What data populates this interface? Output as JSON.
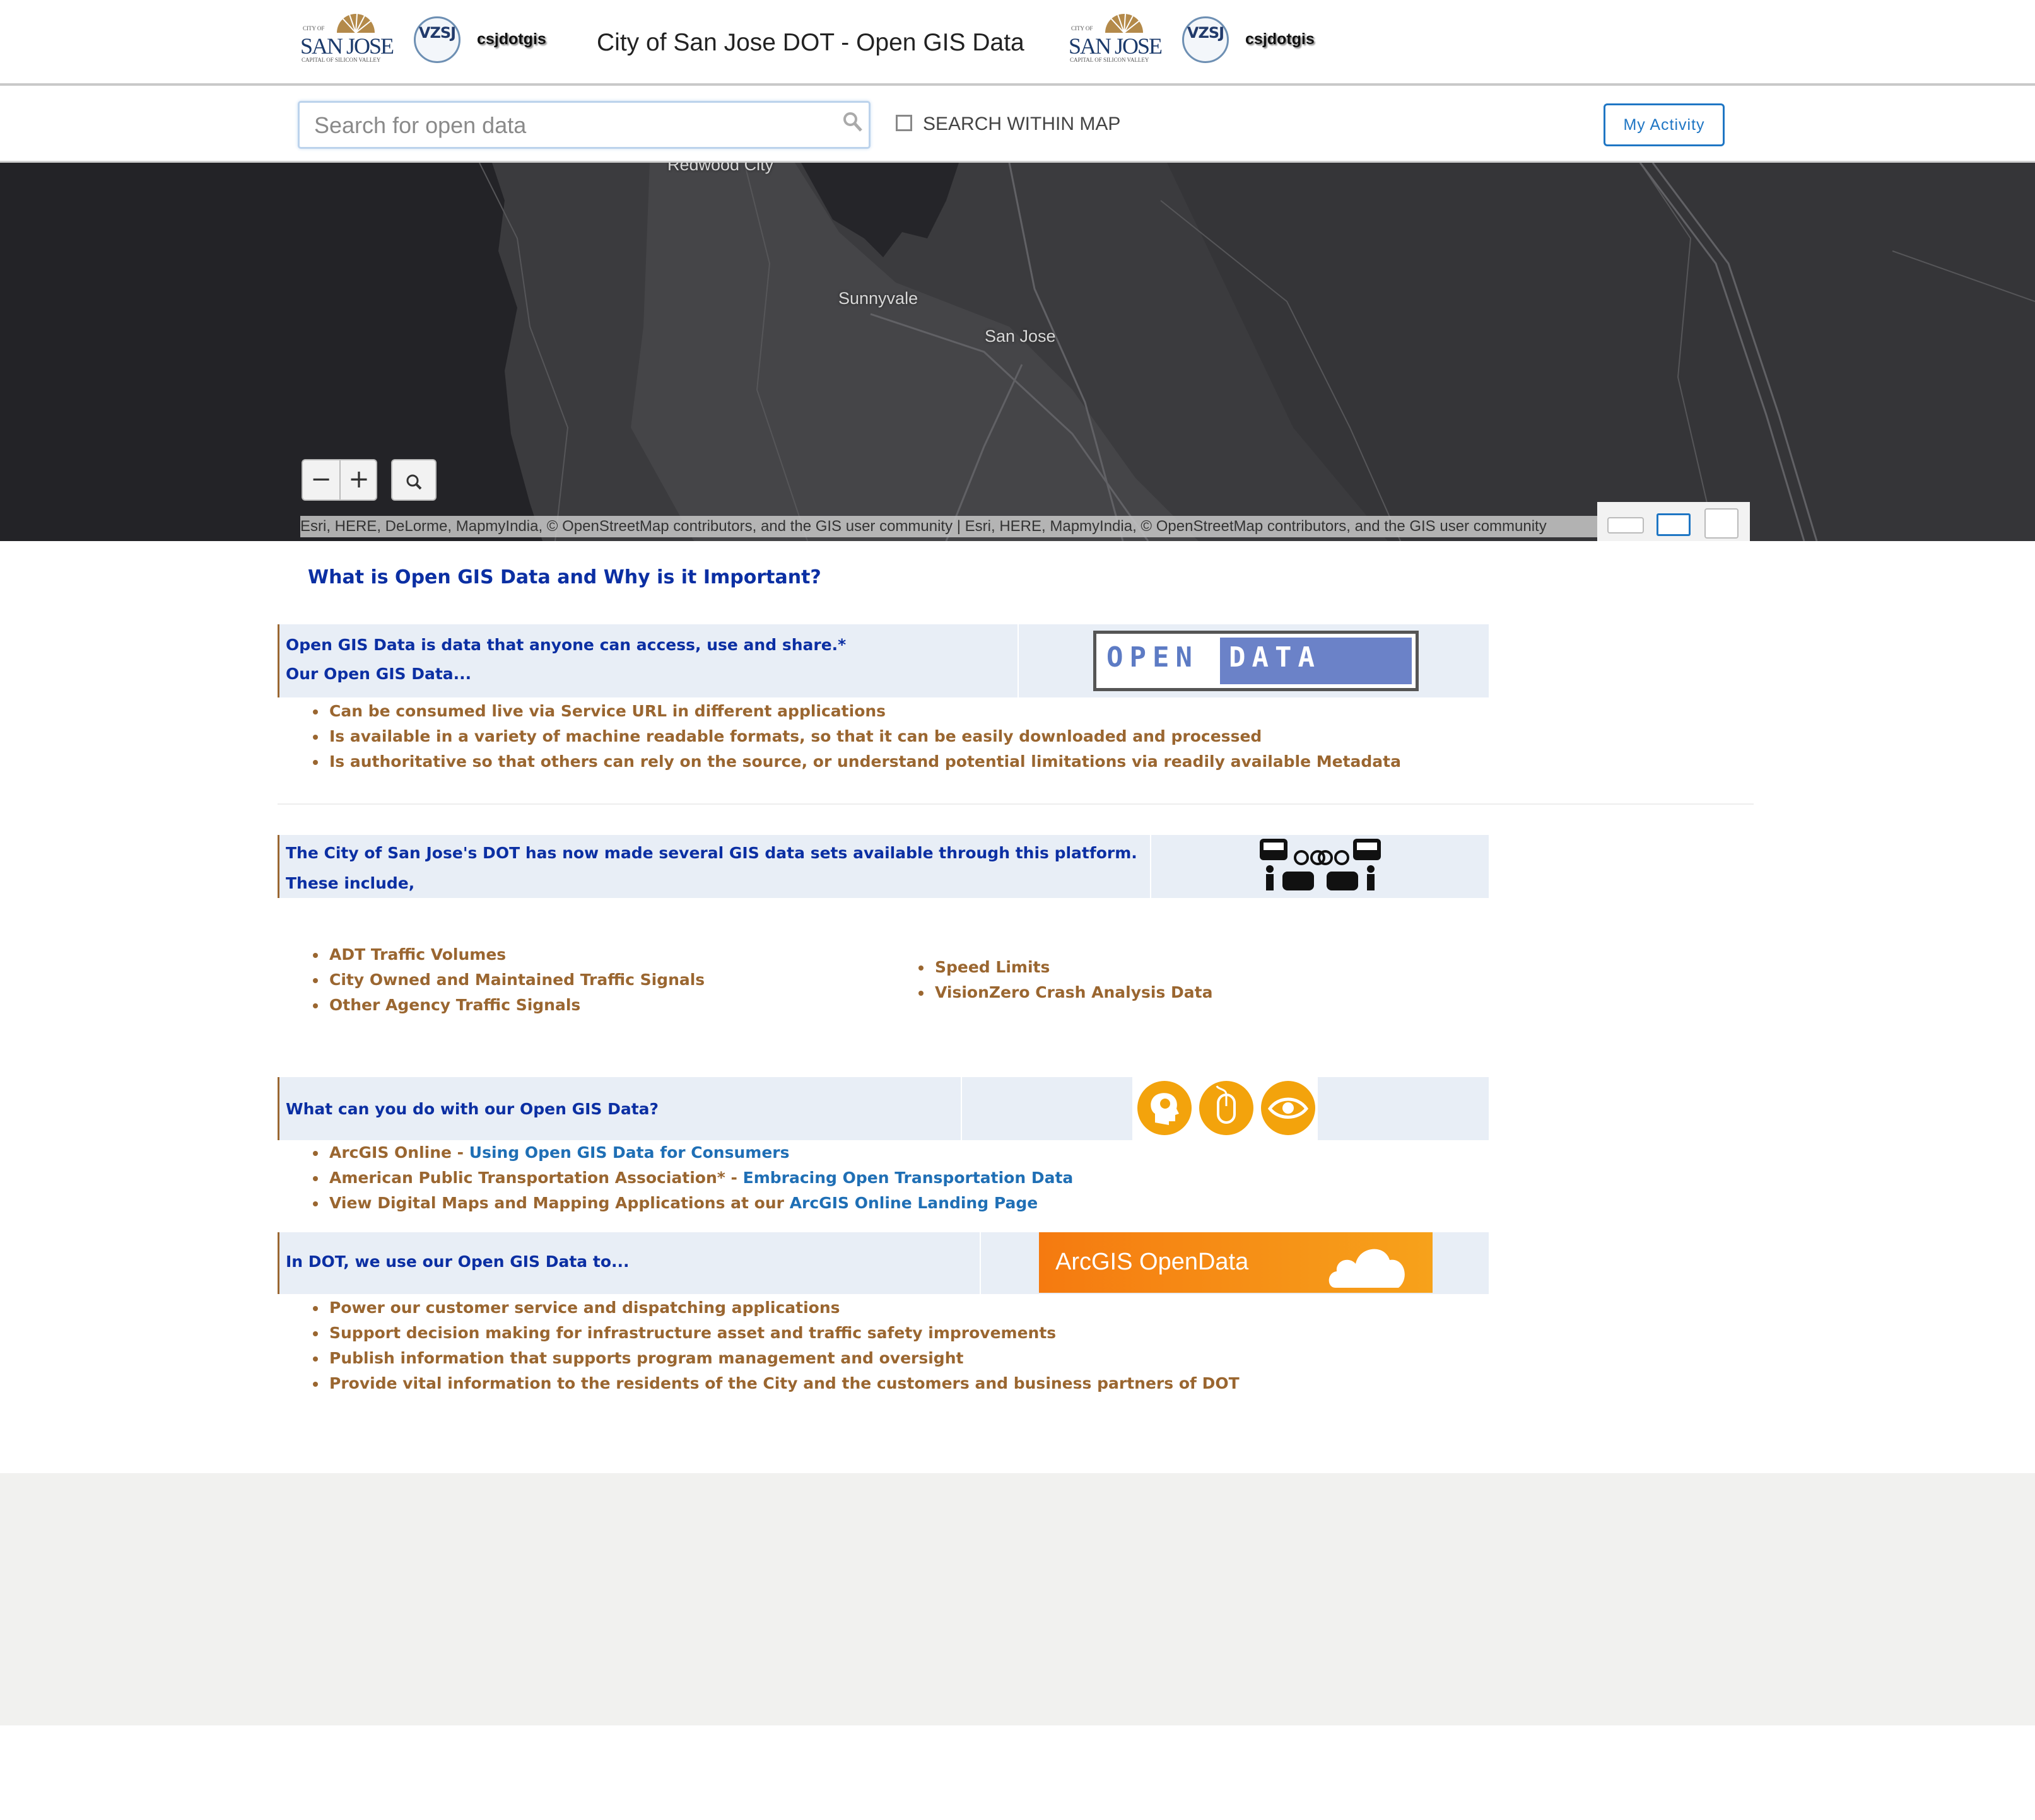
{
  "header": {
    "logo_left_text": "SAN JOSE",
    "logo_left_small": "CITY OF",
    "logo_left_tagline": "CAPITAL OF SILICON VALLEY",
    "vz_badge": "VZSJ",
    "user_name": "csjdotgis",
    "title": "City of San Jose DOT - Open GIS Data",
    "logo_right_text": "SAN JOSE",
    "logo_right_small": "CITY OF",
    "logo_right_tagline": "CAPITAL OF SILICON VALLEY",
    "vz_badge_right": "VZSJ",
    "user_name_right": "csjdotgis"
  },
  "search": {
    "placeholder": "Search for open data",
    "within_map_label": "SEARCH WITHIN MAP",
    "within_map_checked": false,
    "my_activity_label": "My Activity"
  },
  "map": {
    "cities": [
      "Redwood City",
      "Sunnyvale",
      "San Jose"
    ],
    "zoom_out": "−",
    "zoom_in": "+",
    "attribution": "Esri, HERE, DeLorme, MapmyIndia, © OpenStreetMap contributors, and the GIS user community |  Esri, HERE, MapmyIndia, © OpenStreetMap contributors, and the GIS user community"
  },
  "content": {
    "main_heading": "What is Open GIS Data and Why is it Important?",
    "section1": {
      "line1": "Open GIS Data is data that anyone can access, use and share.*",
      "line2": "Our Open GIS Data...",
      "badge_open": "OPEN",
      "badge_data": "DATA",
      "bullets": [
        "Can be consumed live via Service URL in different applications",
        "Is available in a variety of machine readable formats, so that it can be easily downloaded and processed",
        "Is authoritative so that others can rely on the source, or understand potential limitations via readily available Metadata"
      ]
    },
    "section2": {
      "line1": "The City of San Jose's DOT has now made several GIS data sets available through this platform.",
      "line2": "These include,",
      "bullets_left": [
        "ADT Traffic Volumes",
        "City Owned and Maintained Traffic Signals",
        "Other Agency Traffic Signals"
      ],
      "bullets_right": [
        "Speed Limits",
        "VisionZero Crash Analysis Data"
      ]
    },
    "section3": {
      "line1": "What can you do with our Open GIS Data?",
      "items": [
        {
          "prefix": "ArcGIS Online - ",
          "link": "Using Open GIS Data for Consumers"
        },
        {
          "prefix": "American Public Transportation Association* - ",
          "link": "Embracing Open Transportation Data"
        },
        {
          "prefix": "View Digital Maps and Mapping Applications at our ",
          "link": "ArcGIS Online Landing Page"
        }
      ]
    },
    "section4": {
      "line1": "In DOT, we use our Open GIS Data to...",
      "banner_text": "ArcGIS OpenData",
      "bullets": [
        "Power our customer service and dispatching applications",
        "Support decision making for infrastructure asset and traffic safety improvements",
        "Publish information that supports program management and oversight",
        "Provide vital information to the residents of the City and the customers and business partners of DOT"
      ]
    }
  },
  "colors": {
    "heading_blue": "#0b2fa3",
    "body_brown": "#9a6630",
    "link_blue": "#1f6fb5",
    "panel_bg": "#e8eef6",
    "accent_orange": "#f3a30c"
  }
}
